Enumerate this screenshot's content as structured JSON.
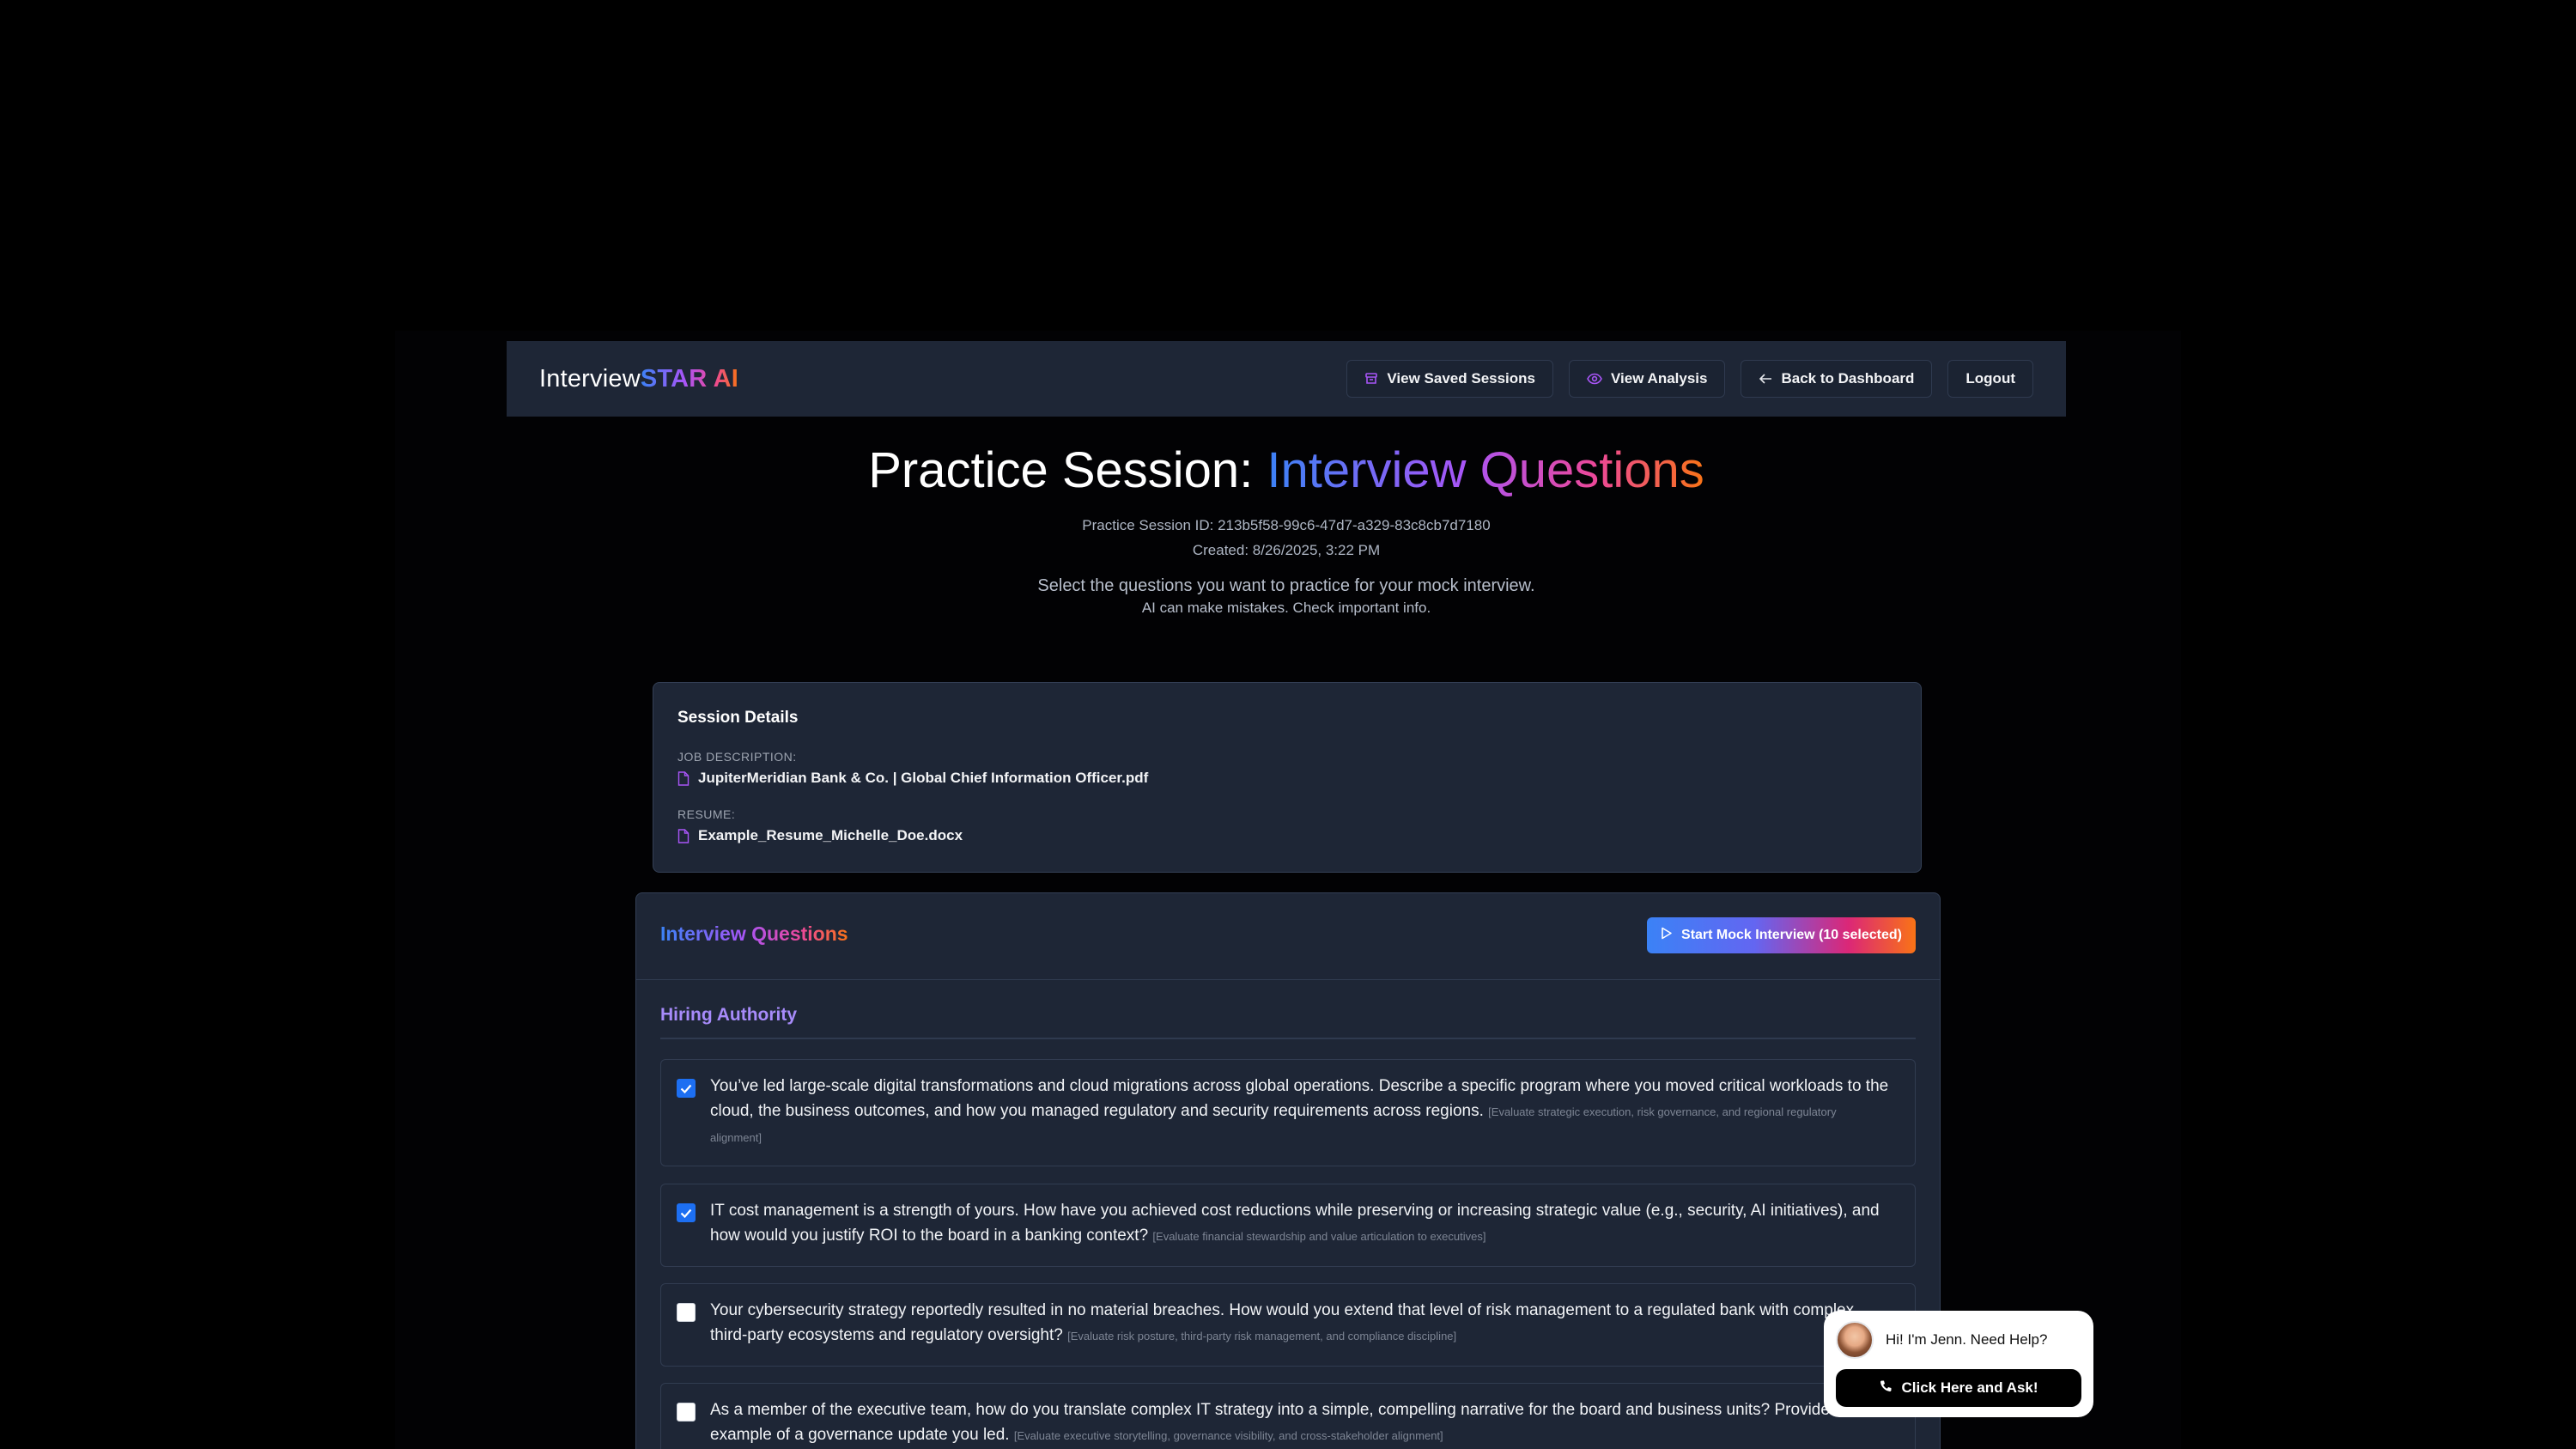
{
  "app": {
    "logo_main": "Interview",
    "logo_accent": "STAR AI"
  },
  "nav": {
    "saved_sessions": "View Saved Sessions",
    "view_analysis": "View Analysis",
    "back_dashboard": "Back to Dashboard",
    "logout": "Logout"
  },
  "header": {
    "title_prefix": "Practice Session: ",
    "title_highlight": "Interview Questions",
    "session_id": "Practice Session ID: 213b5f58-99c6-47d7-a329-83c8cb7d7180",
    "created": "Created: 8/26/2025, 3:22 PM",
    "intro": "Select the questions you want to practice for your mock interview.",
    "disclaimer": "AI can make mistakes. Check important info."
  },
  "session_details": {
    "title": "Session Details",
    "job_label": "JOB DESCRIPTION:",
    "job_file": "JupiterMeridian Bank & Co. | Global Chief Information Officer.pdf",
    "resume_label": "RESUME:",
    "resume_file": "Example_Resume_Michelle_Doe.docx"
  },
  "questions_panel": {
    "title": "Interview Questions",
    "start_button": "Start Mock Interview (10 selected)",
    "category": "Hiring Authority",
    "questions": [
      {
        "checked": true,
        "text": "You’ve led large-scale digital transformations and cloud migrations across global operations. Describe a specific program where you moved critical workloads to the cloud, the business outcomes, and how you managed regulatory and security requirements across regions.",
        "hint": "[Evaluate strategic execution, risk governance, and regional regulatory alignment]"
      },
      {
        "checked": true,
        "text": "IT cost management is a strength of yours. How have you achieved cost reductions while preserving or increasing strategic value (e.g., security, AI initiatives), and how would you justify ROI to the board in a banking context?",
        "hint": "[Evaluate financial stewardship and value articulation to executives]"
      },
      {
        "checked": false,
        "text": "Your cybersecurity strategy reportedly resulted in no material breaches. How would you extend that level of risk management to a regulated bank with complex third-party ecosystems and regulatory oversight?",
        "hint": "[Evaluate risk posture, third-party risk management, and compliance discipline]"
      },
      {
        "checked": false,
        "text": "As a member of the executive team, how do you translate complex IT strategy into a simple, compelling narrative for the board and business units? Provide an example of a governance update you led.",
        "hint": "[Evaluate executive storytelling, governance visibility, and cross-stakeholder alignment]"
      }
    ]
  },
  "help_widget": {
    "greeting": "Hi! I'm Jenn. Need Help?",
    "button": "Click Here and Ask!"
  },
  "colors": {
    "background": "#000000",
    "panel": "#1e2636",
    "accent_blue": "#3b82f6",
    "accent_purple": "#a855f7",
    "accent_pink": "#ec4899",
    "accent_orange": "#f97316",
    "checkbox_checked": "#1d6ff2"
  }
}
